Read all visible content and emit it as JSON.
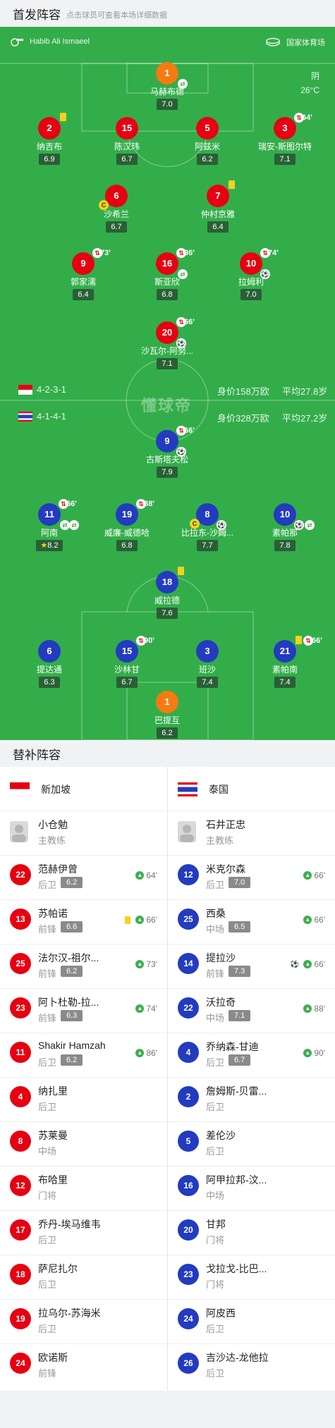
{
  "header": {
    "title": "首发阵容",
    "subtitle": "点击球员可查看本场详细数据"
  },
  "pitch": {
    "referee": "Habib Ali Ismaeel",
    "venue": "国家体育场",
    "weather": "阴",
    "temperature": "26°C",
    "watermark": "懂球帝",
    "home": {
      "formation": "4-2-3-1",
      "value": "身价158万欧",
      "age": "平均27.8岁"
    },
    "away": {
      "formation": "4-1-4-1",
      "value": "身价328万欧",
      "age": "平均27.2岁"
    }
  },
  "home_players": [
    {
      "num": "1",
      "name": "马赫布德",
      "rating": "7.0",
      "type": "gk"
    },
    {
      "num": "2",
      "name": "纳吉布",
      "rating": "6.9",
      "type": "red"
    },
    {
      "num": "15",
      "name": "陈汉玮",
      "rating": "6.7",
      "type": "red"
    },
    {
      "num": "5",
      "name": "阿兹米",
      "rating": "6.2",
      "type": "red"
    },
    {
      "num": "3",
      "name": "瑞安-斯图尔特",
      "rating": "7.1",
      "type": "red",
      "min": "64'"
    },
    {
      "num": "6",
      "name": "沙希兰",
      "rating": "6.7",
      "type": "red"
    },
    {
      "num": "7",
      "name": "仲村京雅",
      "rating": "6.4",
      "type": "red"
    },
    {
      "num": "9",
      "name": "郭家濡",
      "rating": "6.4",
      "type": "red",
      "min": "73'"
    },
    {
      "num": "16",
      "name": "斯亚欣",
      "rating": "6.8",
      "type": "red",
      "min": "86'"
    },
    {
      "num": "10",
      "name": "拉姆利",
      "rating": "7.0",
      "type": "red",
      "min": "74'"
    },
    {
      "num": "20",
      "name": "沙瓦尔-阿努...",
      "rating": "7.1",
      "type": "red",
      "min": "66'"
    }
  ],
  "away_players": [
    {
      "num": "9",
      "name": "古斯塔夫松",
      "rating": "7.9",
      "type": "blue",
      "min": "66'"
    },
    {
      "num": "11",
      "name": "阿南",
      "rating": "8.2",
      "type": "blue",
      "min": "66'"
    },
    {
      "num": "19",
      "name": "威廉-威德哈",
      "rating": "6.8",
      "type": "blue",
      "min": "88'"
    },
    {
      "num": "8",
      "name": "比拉东-沙姆...",
      "rating": "7.7",
      "type": "blue"
    },
    {
      "num": "10",
      "name": "素帕那",
      "rating": "7.8",
      "type": "blue"
    },
    {
      "num": "18",
      "name": "威拉德",
      "rating": "7.6",
      "type": "blue"
    },
    {
      "num": "6",
      "name": "提达通",
      "rating": "6.3",
      "type": "blue"
    },
    {
      "num": "15",
      "name": "沙林甘",
      "rating": "6.7",
      "type": "blue",
      "min": "90'"
    },
    {
      "num": "3",
      "name": "班沙",
      "rating": "7.4",
      "type": "blue"
    },
    {
      "num": "21",
      "name": "素帕南",
      "rating": "7.4",
      "type": "blue",
      "min": "66'"
    },
    {
      "num": "1",
      "name": "巴提互",
      "rating": "6.2",
      "type": "gk"
    }
  ],
  "subs_header": {
    "title": "替补阵容"
  },
  "subs": {
    "home_team": "新加坡",
    "away_team": "泰国",
    "home_coach": {
      "name": "小仓勉",
      "role": "主教练"
    },
    "away_coach": {
      "name": "石井正忠",
      "role": "主教练"
    },
    "home": [
      {
        "num": "22",
        "name": "范赫伊曾",
        "pos": "后卫",
        "rating": "6.2",
        "time": "64'"
      },
      {
        "num": "13",
        "name": "苏帕诺",
        "pos": "前锋",
        "rating": "6.6",
        "time": "66'",
        "yellow": true
      },
      {
        "num": "25",
        "name": "法尔汉-祖尔...",
        "pos": "前锋",
        "rating": "6.2",
        "time": "73'"
      },
      {
        "num": "23",
        "name": "阿卜杜勒-拉...",
        "pos": "前锋",
        "rating": "6.3",
        "time": "74'"
      },
      {
        "num": "11",
        "name": "Shakir Hamzah",
        "pos": "后卫",
        "rating": "6.2",
        "time": "86'"
      },
      {
        "num": "4",
        "name": "纳扎里",
        "pos": "后卫"
      },
      {
        "num": "8",
        "name": "苏莱曼",
        "pos": "中场"
      },
      {
        "num": "12",
        "name": "布哈里",
        "pos": "门将"
      },
      {
        "num": "17",
        "name": "乔丹-埃马维韦",
        "pos": "后卫"
      },
      {
        "num": "18",
        "name": "萨尼扎尔",
        "pos": "后卫"
      },
      {
        "num": "19",
        "name": "拉乌尔-苏海米",
        "pos": "后卫"
      },
      {
        "num": "24",
        "name": "欧诺斯",
        "pos": "前锋"
      }
    ],
    "away": [
      {
        "num": "12",
        "name": "米克尔森",
        "pos": "后卫",
        "rating": "7.0",
        "time": "66'"
      },
      {
        "num": "25",
        "name": "西桑",
        "pos": "中场",
        "rating": "6.5",
        "time": "66'"
      },
      {
        "num": "14",
        "name": "提拉沙",
        "pos": "前锋",
        "rating": "7.3",
        "time": "66'",
        "ball": true
      },
      {
        "num": "22",
        "name": "沃拉奇",
        "pos": "中场",
        "rating": "7.1",
        "time": "88'"
      },
      {
        "num": "4",
        "name": "乔纳森-甘迪",
        "pos": "后卫",
        "rating": "6.7",
        "time": "90'"
      },
      {
        "num": "2",
        "name": "詹姆斯-贝雷...",
        "pos": "后卫"
      },
      {
        "num": "5",
        "name": "差伦沙",
        "pos": "后卫"
      },
      {
        "num": "16",
        "name": "阿甲拉邦-汶...",
        "pos": "中场"
      },
      {
        "num": "20",
        "name": "甘邦",
        "pos": "门将"
      },
      {
        "num": "23",
        "name": "戈拉戈-比巴...",
        "pos": "门将"
      },
      {
        "num": "24",
        "name": "阿皮西",
        "pos": "后卫"
      },
      {
        "num": "26",
        "name": "吉沙达-龙他拉",
        "pos": "后卫"
      }
    ]
  },
  "colors": {
    "pitch": "#33ad4a",
    "home": "#e60012",
    "away": "#233bbf",
    "gk": "#f67a12",
    "rating_bg": "#2a5f36"
  }
}
